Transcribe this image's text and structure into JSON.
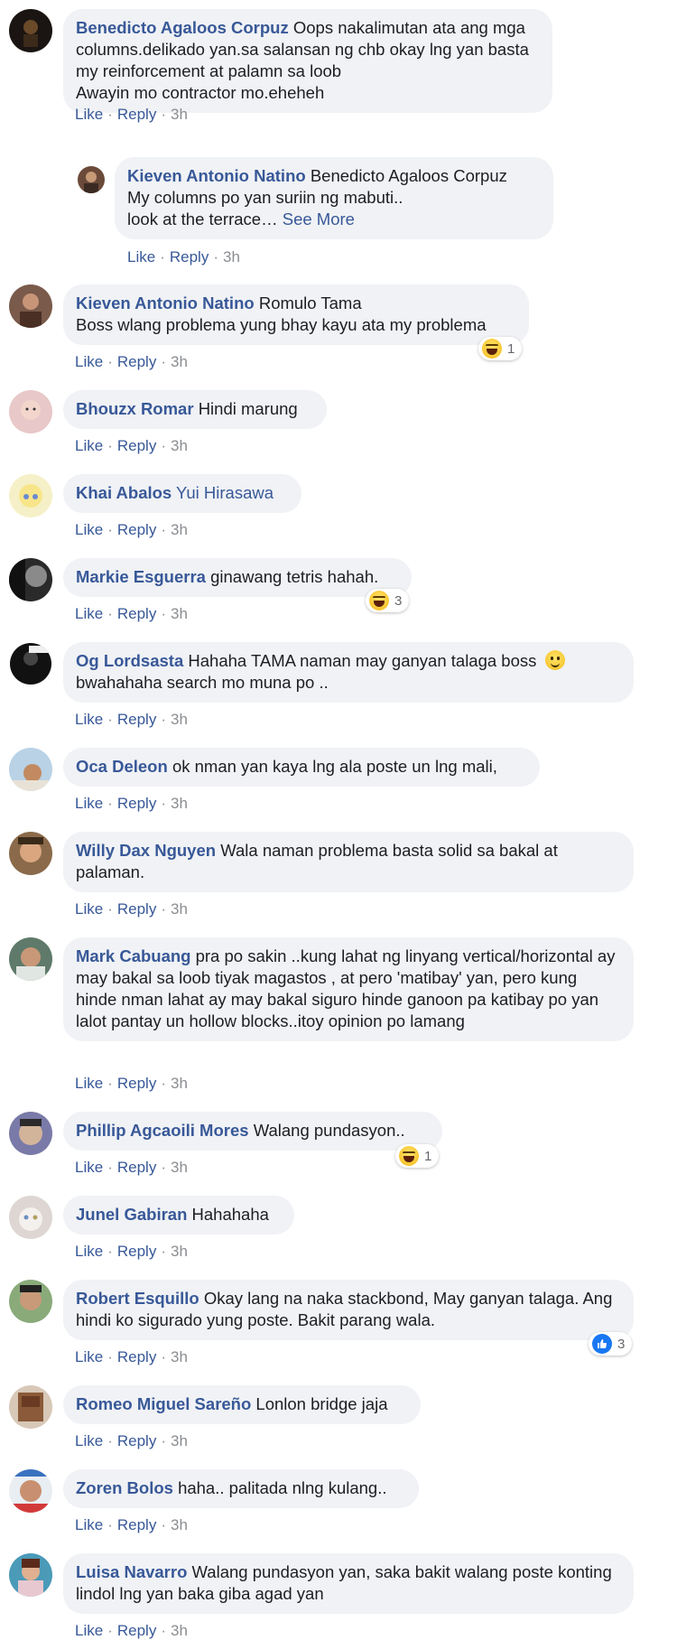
{
  "actions": {
    "like": "Like",
    "reply": "Reply",
    "time": "3h",
    "sep": "·"
  },
  "comments": [
    {
      "author": "Benedicto Agaloos Corpuz",
      "mention": "",
      "text": "Oops nakalimutan ata ang mga columns.delikado yan.sa salansan ng chb okay lng yan basta my reinforcement at palamn sa loob\nAwayin mo contractor mo.eheheh",
      "time": "3h"
    },
    {
      "author": "Kieven Antonio Natino",
      "mention": "",
      "text": "Benedicto Agaloos Corpuz\nMy columns po yan suriin ng mabuti..\nlook at the terrace…",
      "see_more": "See More",
      "time": "3h"
    },
    {
      "author": "Kieven Antonio Natino",
      "mention": "",
      "text": "Romulo Tama\nBoss wlang problema yung bhay kayu ata my problema",
      "reaction": {
        "icon": "haha-icon",
        "count": "1"
      },
      "time": "3h"
    },
    {
      "author": "Bhouzx Romar",
      "mention": "",
      "text": "Hindi marung",
      "time": "3h"
    },
    {
      "author": "Khai Abalos",
      "mention": "Yui Hirasawa",
      "text": "",
      "time": "3h"
    },
    {
      "author": "Markie Esguerra",
      "mention": "",
      "text": "ginawang tetris hahah.",
      "reaction": {
        "icon": "haha-icon",
        "count": "3"
      },
      "time": "3h"
    },
    {
      "author": "Og Lordsasta",
      "mention": "",
      "text": "Hahaha TAMA naman may ganyan talaga boss",
      "text2": "bwahahaha search mo muna po ..",
      "emoji": "smile-emoji",
      "time": "3h"
    },
    {
      "author": "Oca Deleon",
      "mention": "",
      "text": "ok nman yan kaya lng ala poste un lng mali,",
      "time": "3h"
    },
    {
      "author": "Willy Dax Nguyen",
      "mention": "",
      "text": "Wala naman problema basta solid sa bakal at palaman.",
      "time": "3h"
    },
    {
      "author": "Mark Cabuang",
      "mention": "",
      "text": "pra po sakin ..kung lahat ng linyang vertical/horizontal ay may bakal sa loob tiyak magastos , at pero 'matibay' yan, pero kung hinde nman lahat ay may bakal siguro hinde ganoon pa katibay po yan lalot pantay un hollow blocks..itoy opinion po lamang",
      "time": "3h"
    },
    {
      "author": "Phillip Agcaoili Mores",
      "mention": "",
      "text": "Walang pundasyon..",
      "reaction": {
        "icon": "haha-icon",
        "count": "1"
      },
      "time": "3h"
    },
    {
      "author": "Junel Gabiran",
      "mention": "",
      "text": "Hahahaha",
      "time": "3h"
    },
    {
      "author": "Robert Esquillo",
      "mention": "",
      "text": "Okay lang na naka stackbond, May ganyan talaga. Ang hindi ko sigurado yung poste. Bakit parang wala.",
      "reaction": {
        "icon": "like-icon",
        "count": "3"
      },
      "time": "3h"
    },
    {
      "author": "Romeo Miguel Sareño",
      "mention": "",
      "text": "Lonlon bridge jaja",
      "time": "3h"
    },
    {
      "author": "Zoren Bolos",
      "mention": "",
      "text": "haha.. palitada nlng kulang..",
      "time": "3h"
    },
    {
      "author": "Luisa Navarro",
      "mention": "",
      "text": "Walang pundasyon yan, saka bakit walang poste konting lindol lng yan baka giba agad yan",
      "time": "3h"
    }
  ],
  "colors": {
    "name": "#385898",
    "bubble": "#f0f2f5",
    "meta": "#8a8d91",
    "like_blue": "#1877f2",
    "haha_yellow": "#f8c630"
  }
}
